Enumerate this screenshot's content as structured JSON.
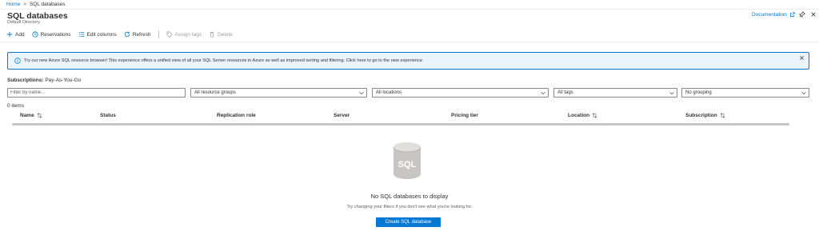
{
  "breadcrumb": {
    "home": "Home",
    "separator": ">",
    "current": "SQL databases"
  },
  "header": {
    "title": "SQL databases",
    "subtitle": "Default Directory",
    "documentation_label": "Documentation"
  },
  "toolbar": {
    "add": "Add",
    "reservations": "Reservations",
    "edit_columns": "Edit columns",
    "refresh": "Refresh",
    "assign_tags": "Assign tags",
    "delete": "Delete"
  },
  "banner": {
    "text": "Try our new Azure SQL resource browser! This experience offers a unified view of all your SQL Server resources in Azure as well as improved sorting and filtering. Click here to go to the new experience."
  },
  "subscriptions": {
    "label": "Subscriptions:",
    "value": "Pay-As-You-Go"
  },
  "filters": {
    "name_placeholder": "Filter by name...",
    "resource_groups": "All resource groups",
    "locations": "All locations",
    "tags": "All tags",
    "grouping": "No grouping"
  },
  "count": "0 items",
  "columns": {
    "name": "Name",
    "status": "Status",
    "replication_role": "Replication role",
    "server": "Server",
    "pricing_tier": "Pricing tier",
    "location": "Location",
    "subscription": "Subscription"
  },
  "empty_state": {
    "icon_text": "SQL",
    "title": "No SQL databases to display",
    "hint": "Try changing your filters if you don't see what you're looking for.",
    "button": "Create SQL database"
  },
  "colors": {
    "accent": "#0078d4",
    "banner_bg": "#ebf3fc",
    "disabled": "#a19f9d"
  }
}
